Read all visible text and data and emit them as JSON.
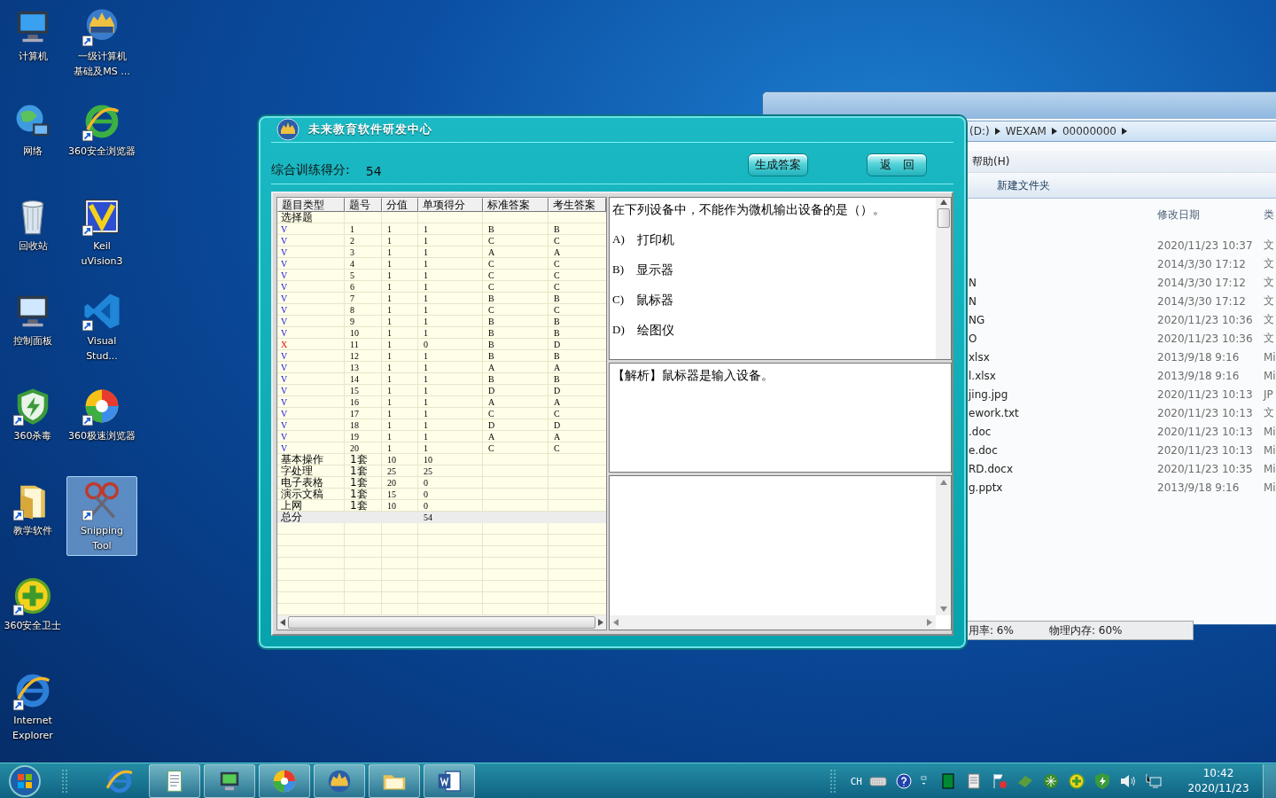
{
  "desktop_icons": [
    {
      "label": "计算机",
      "selected": false
    },
    {
      "label": "网络",
      "selected": false
    },
    {
      "label": "回收站",
      "selected": false
    },
    {
      "label": "控制面板",
      "selected": false
    },
    {
      "label": "360杀毒",
      "selected": false
    },
    {
      "label": "教学软件",
      "selected": false
    },
    {
      "label": "360安全卫士",
      "selected": false
    },
    {
      "label": "Internet Explorer",
      "selected": false
    },
    {
      "label": "一级计算机基础及MS ...",
      "selected": false
    },
    {
      "label": "360安全浏览器",
      "selected": false
    },
    {
      "label": "Keil uVision3",
      "selected": false
    },
    {
      "label": "Visual Stud...",
      "selected": false
    },
    {
      "label": "360极速浏览器",
      "selected": false
    },
    {
      "label": "Snipping Tool",
      "selected": true
    }
  ],
  "explorer": {
    "breadcrumbs": [
      "(D:)",
      "WEXAM",
      "00000000"
    ],
    "menu": [
      "帮助(H)"
    ],
    "toolbar": [
      "新建文件夹"
    ],
    "columns": [
      "修改日期",
      "类"
    ],
    "files": [
      {
        "modified": "2020/11/23 10:37",
        "type": "文"
      },
      {
        "modified": "2014/3/30 17:12",
        "type": "文"
      },
      {
        "name": "N",
        "modified": "2014/3/30 17:12",
        "type": "文"
      },
      {
        "name": "N",
        "modified": "2014/3/30 17:12",
        "type": "文"
      },
      {
        "name": "NG",
        "modified": "2020/11/23 10:36",
        "type": "文"
      },
      {
        "name": "O",
        "modified": "2020/11/23 10:36",
        "type": "文"
      },
      {
        "name": "xlsx",
        "modified": "2013/9/18 9:16",
        "type": "Mi"
      },
      {
        "name": "l.xlsx",
        "modified": "2013/9/18 9:16",
        "type": "Mi"
      },
      {
        "name": "jing.jpg",
        "modified": "2020/11/23 10:13",
        "type": "JP"
      },
      {
        "name": "ework.txt",
        "modified": "2020/11/23 10:13",
        "type": "文"
      },
      {
        "name": ".doc",
        "modified": "2020/11/23 10:13",
        "type": "Mi"
      },
      {
        "name": "e.doc",
        "modified": "2020/11/23 10:13",
        "type": "Mi"
      },
      {
        "name": "RD.docx",
        "modified": "2020/11/23 10:35",
        "type": "Mi"
      },
      {
        "name": "g.pptx",
        "modified": "2013/9/18 9:16",
        "type": "Mi"
      }
    ],
    "status": [
      "用率: 6%",
      "物理内存: 60%"
    ]
  },
  "dialog": {
    "title": "未来教育软件研发中心",
    "score_label": "综合训练得分:",
    "score": "54",
    "buttons": [
      "生成答案",
      "返　回"
    ],
    "table": {
      "columns": [
        "题目类型",
        "题号",
        "分值",
        "单项得分",
        "标准答案",
        "考生答案"
      ],
      "rows": [
        {
          "kind": "section",
          "cells": [
            "选择题"
          ]
        },
        {
          "kind": "question",
          "correct": true,
          "cells": [
            "V",
            "1",
            "1",
            "1",
            "B",
            "B"
          ]
        },
        {
          "kind": "question",
          "correct": true,
          "cells": [
            "V",
            "2",
            "1",
            "1",
            "C",
            "C"
          ]
        },
        {
          "kind": "question",
          "correct": true,
          "cells": [
            "V",
            "3",
            "1",
            "1",
            "A",
            "A"
          ]
        },
        {
          "kind": "question",
          "correct": true,
          "cells": [
            "V",
            "4",
            "1",
            "1",
            "C",
            "C"
          ]
        },
        {
          "kind": "question",
          "correct": true,
          "cells": [
            "V",
            "5",
            "1",
            "1",
            "C",
            "C"
          ]
        },
        {
          "kind": "question",
          "correct": true,
          "cells": [
            "V",
            "6",
            "1",
            "1",
            "C",
            "C"
          ]
        },
        {
          "kind": "question",
          "correct": true,
          "cells": [
            "V",
            "7",
            "1",
            "1",
            "B",
            "B"
          ]
        },
        {
          "kind": "question",
          "correct": true,
          "cells": [
            "V",
            "8",
            "1",
            "1",
            "C",
            "C"
          ]
        },
        {
          "kind": "question",
          "correct": true,
          "cells": [
            "V",
            "9",
            "1",
            "1",
            "B",
            "B"
          ]
        },
        {
          "kind": "question",
          "correct": true,
          "cells": [
            "V",
            "10",
            "1",
            "1",
            "B",
            "B"
          ]
        },
        {
          "kind": "question",
          "correct": false,
          "cells": [
            "X",
            "11",
            "1",
            "0",
            "B",
            "D"
          ]
        },
        {
          "kind": "question",
          "correct": true,
          "cells": [
            "V",
            "12",
            "1",
            "1",
            "B",
            "B"
          ]
        },
        {
          "kind": "question",
          "correct": true,
          "cells": [
            "V",
            "13",
            "1",
            "1",
            "A",
            "A"
          ]
        },
        {
          "kind": "question",
          "correct": true,
          "cells": [
            "V",
            "14",
            "1",
            "1",
            "B",
            "B"
          ]
        },
        {
          "kind": "question",
          "correct": true,
          "cells": [
            "V",
            "15",
            "1",
            "1",
            "D",
            "D"
          ]
        },
        {
          "kind": "question",
          "correct": true,
          "cells": [
            "V",
            "16",
            "1",
            "1",
            "A",
            "A"
          ]
        },
        {
          "kind": "question",
          "correct": true,
          "cells": [
            "V",
            "17",
            "1",
            "1",
            "C",
            "C"
          ]
        },
        {
          "kind": "question",
          "correct": true,
          "cells": [
            "V",
            "18",
            "1",
            "1",
            "D",
            "D"
          ]
        },
        {
          "kind": "question",
          "correct": true,
          "cells": [
            "V",
            "19",
            "1",
            "1",
            "A",
            "A"
          ]
        },
        {
          "kind": "question",
          "correct": true,
          "cells": [
            "V",
            "20",
            "1",
            "1",
            "C",
            "C"
          ]
        },
        {
          "kind": "category",
          "cells": [
            "基本操作",
            "1套",
            "10",
            "10"
          ]
        },
        {
          "kind": "category",
          "cells": [
            "字处理",
            "1套",
            "25",
            "25"
          ]
        },
        {
          "kind": "category",
          "cells": [
            "电子表格",
            "1套",
            "20",
            "0"
          ]
        },
        {
          "kind": "category",
          "cells": [
            "演示文稿",
            "1套",
            "15",
            "0"
          ]
        },
        {
          "kind": "category",
          "cells": [
            "上网",
            "1套",
            "10",
            "0"
          ]
        },
        {
          "kind": "total",
          "cells": [
            "总分",
            "",
            "",
            "54"
          ]
        }
      ]
    },
    "question": {
      "stem": "在下列设备中，不能作为微机输出设备的是（）。",
      "options": [
        {
          "letter": "A)",
          "text": "打印机"
        },
        {
          "letter": "B)",
          "text": "显示器"
        },
        {
          "letter": "C)",
          "text": "鼠标器"
        },
        {
          "letter": "D)",
          "text": "绘图仪"
        }
      ]
    },
    "analysis": "【解析】鼠标器是输入设备。"
  },
  "taskbar": {
    "language": "CH",
    "time": "10:42",
    "date": "2020/11/23"
  }
}
